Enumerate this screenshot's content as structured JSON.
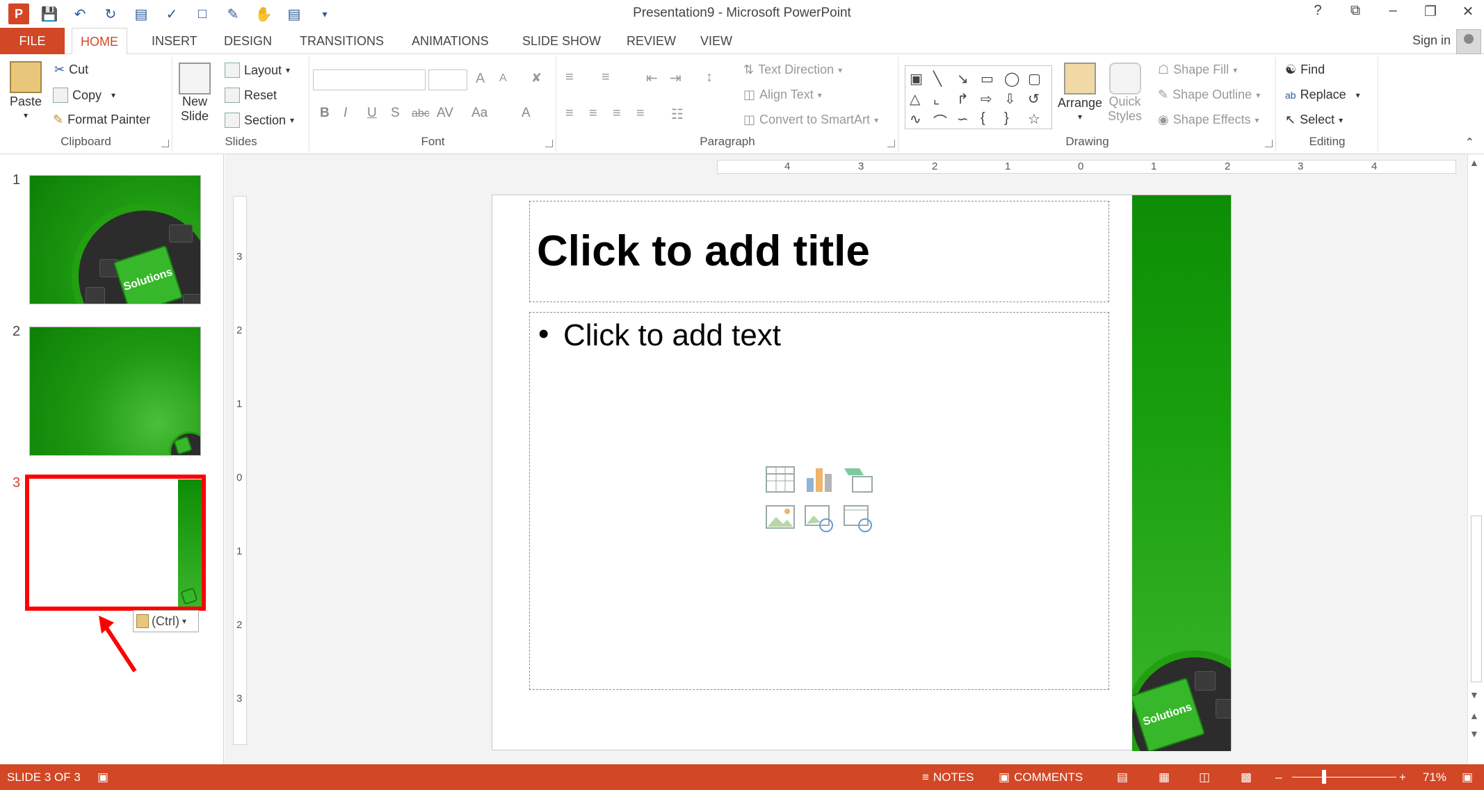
{
  "window": {
    "title": "Presentation9 - Microsoft PowerPoint",
    "help": "?",
    "controls": [
      "?",
      "⧉",
      "–",
      "❐",
      "✕"
    ]
  },
  "tabs": [
    "FILE",
    "HOME",
    "INSERT",
    "DESIGN",
    "TRANSITIONS",
    "ANIMATIONS",
    "SLIDE SHOW",
    "REVIEW",
    "VIEW"
  ],
  "active_tab": "HOME",
  "signin": "Sign in",
  "ribbon": {
    "clipboard": {
      "label": "Clipboard",
      "paste": "Paste",
      "cut": "Cut",
      "copy": "Copy",
      "format_painter": "Format Painter"
    },
    "slides": {
      "label": "Slides",
      "new_slide_1": "New",
      "new_slide_2": "Slide",
      "layout": "Layout",
      "reset": "Reset",
      "section": "Section"
    },
    "font": {
      "label": "Font",
      "bold": "B",
      "italic": "I",
      "underline": "U",
      "shadow": "S",
      "strike": "abc",
      "spacing": "AV",
      "case": "Aa",
      "color": "A",
      "grow": "A",
      "shrink": "A"
    },
    "paragraph": {
      "label": "Paragraph",
      "text_direction": "Text Direction",
      "align_text": "Align Text",
      "smartart": "Convert to SmartArt"
    },
    "drawing": {
      "label": "Drawing",
      "arrange": "Arrange",
      "quick_styles_1": "Quick",
      "quick_styles_2": "Styles",
      "shape_fill": "Shape Fill",
      "shape_outline": "Shape Outline",
      "shape_effects": "Shape Effects"
    },
    "editing": {
      "label": "Editing",
      "find": "Find",
      "replace": "Replace",
      "select": "Select"
    }
  },
  "thumbnails": [
    {
      "num": "1",
      "key_label": "Solutions"
    },
    {
      "num": "2"
    },
    {
      "num": "3"
    }
  ],
  "paste_options": "(Ctrl)",
  "ruler": {
    "h": [
      "4",
      "3",
      "2",
      "1",
      "0",
      "1",
      "2",
      "3",
      "4"
    ],
    "v": [
      "3",
      "2",
      "1",
      "0",
      "1",
      "2",
      "3"
    ]
  },
  "slide": {
    "title_placeholder": "Click to add title",
    "body_placeholder": "Click to add text",
    "bullet": "•",
    "key_label": "Solutions"
  },
  "status": {
    "slide_info": "SLIDE 3 OF 3",
    "notes": "NOTES",
    "comments": "COMMENTS",
    "zoom": "71%",
    "minus": "–",
    "plus": "+"
  },
  "colors": {
    "accent": "#d24726",
    "slide_green": "#1a9e0e",
    "selection_red": "#ff0000"
  }
}
